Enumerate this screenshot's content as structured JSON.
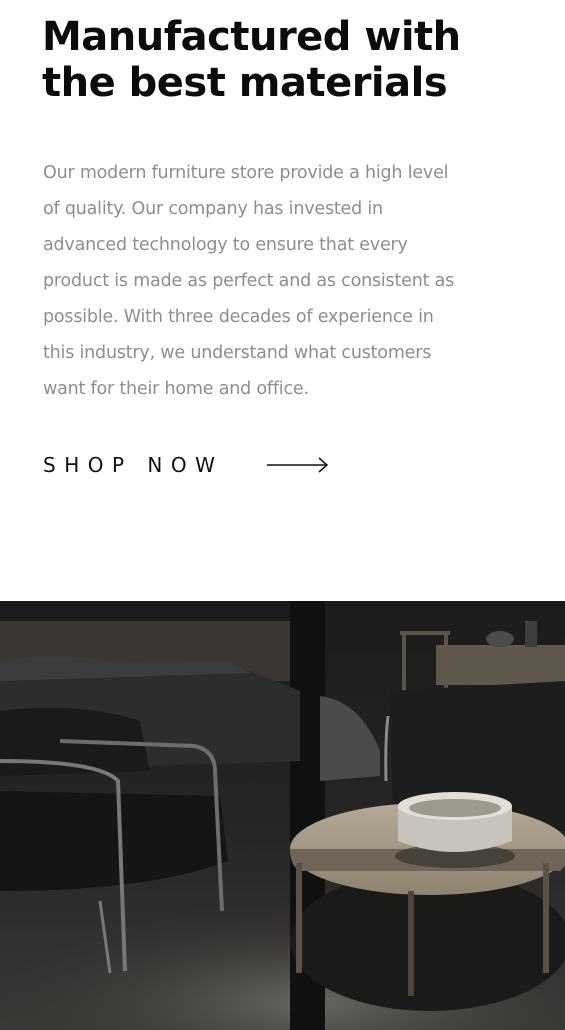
{
  "hero": {
    "heading_lines": [
      "Manufactured with",
      "the best materials"
    ],
    "body_lines": [
      "Our modern furniture store provide a high level",
      "of quality. Our company has invested in",
      "advanced technology to ensure that every",
      "product is made as perfect and as consistent as",
      "possible. With three decades of experience in",
      "this industry, we understand what customers",
      "want for their home and office."
    ],
    "cta": {
      "label": "SHOP NOW",
      "icon": "arrow-right-icon"
    }
  },
  "image": {
    "subject": "furniture-showroom-photo"
  },
  "colors": {
    "heading": "#0c0c0c",
    "body": "#8e8e8e",
    "background": "#ffffff"
  }
}
